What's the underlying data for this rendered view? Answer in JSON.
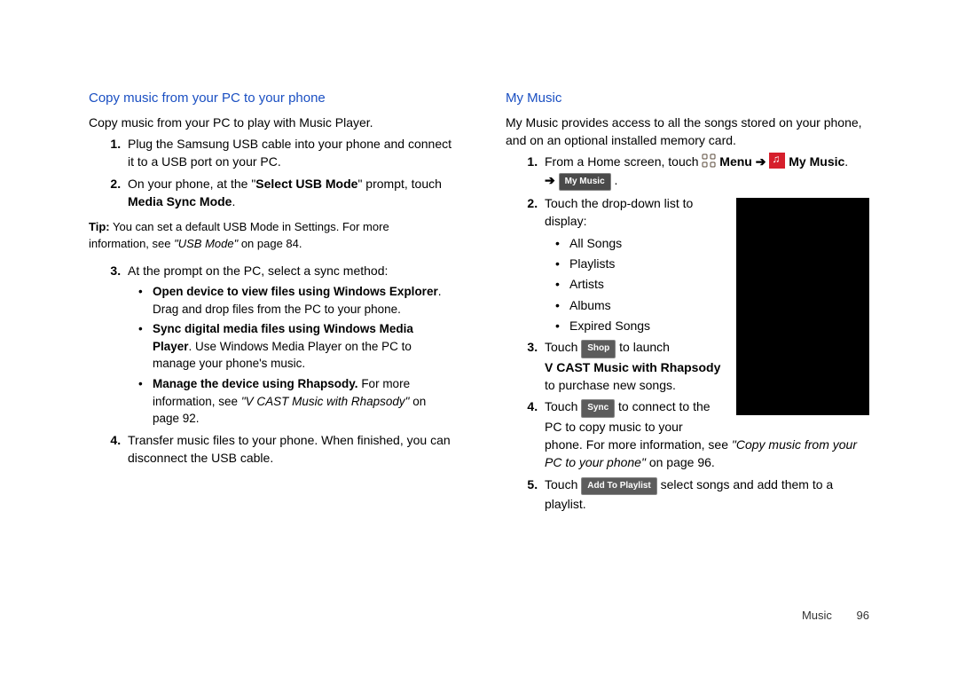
{
  "left": {
    "heading": "Copy music from your PC to your phone",
    "intro": "Copy music from your PC to play with Music Player.",
    "step1": "Plug the Samsung USB cable into your phone and connect it to a USB port on your PC.",
    "step2_a": "On your phone, at the \"",
    "step2_b": "Select USB Mode",
    "step2_c": "\" prompt, touch ",
    "step2_d": "Media Sync Mode",
    "step2_e": ".",
    "tip_label": "Tip:",
    "tip_a": "You can set a default USB Mode in Settings. For more information, see ",
    "tip_b": "\"USB Mode\"",
    "tip_c": " on page 84.",
    "step3": "At the prompt on the PC, select a sync method:",
    "s3_b1a": "Open device to view files using Windows Explorer",
    "s3_b1b": ". Drag and drop files from the PC to your phone.",
    "s3_b2a": "Sync digital media files using Windows Media Player",
    "s3_b2b": ". Use Windows Media Player on the PC to manage your phone's music.",
    "s3_b3a": "Manage the device using Rhapsody.",
    "s3_b3b": " For more information, see ",
    "s3_b3c": "\"V CAST Music with Rhapsody\"",
    "s3_b3d": " on page 92.",
    "step4": "Transfer music files to your phone. When finished, you can disconnect the USB cable."
  },
  "right": {
    "heading": "My Music",
    "intro": "My Music provides access to all the songs stored on your phone, and on an optional installed memory card.",
    "step1_a": "From a Home screen, touch ",
    "step1_menu": "Menu",
    "step1_arrow": "➔",
    "step1_mymusic": "My Music",
    "step1_dot": ".",
    "badge_mymusic": "My Music",
    "step2": "Touch the drop-down list to display:",
    "dd": {
      "a": "All Songs",
      "b": "Playlists",
      "c": "Artists",
      "d": "Albums",
      "e": "Expired Songs"
    },
    "step3_a": "Touch ",
    "badge_shop": "Shop",
    "step3_b": " to launch ",
    "step3_c": "V CAST Music with Rhapsody",
    "step3_d": " to purchase new songs.",
    "step4_a": "Touch ",
    "badge_sync": "Sync",
    "step4_b": " to connect to the PC to copy music to your phone. For more information, see ",
    "step4_c": "\"Copy music from your PC to your phone\"",
    "step4_d": " on page 96.",
    "step5_a": "Touch ",
    "badge_add": "Add To Playlist",
    "step5_b": " select songs and add them to a playlist."
  },
  "footer": {
    "section": "Music",
    "page": "96"
  }
}
